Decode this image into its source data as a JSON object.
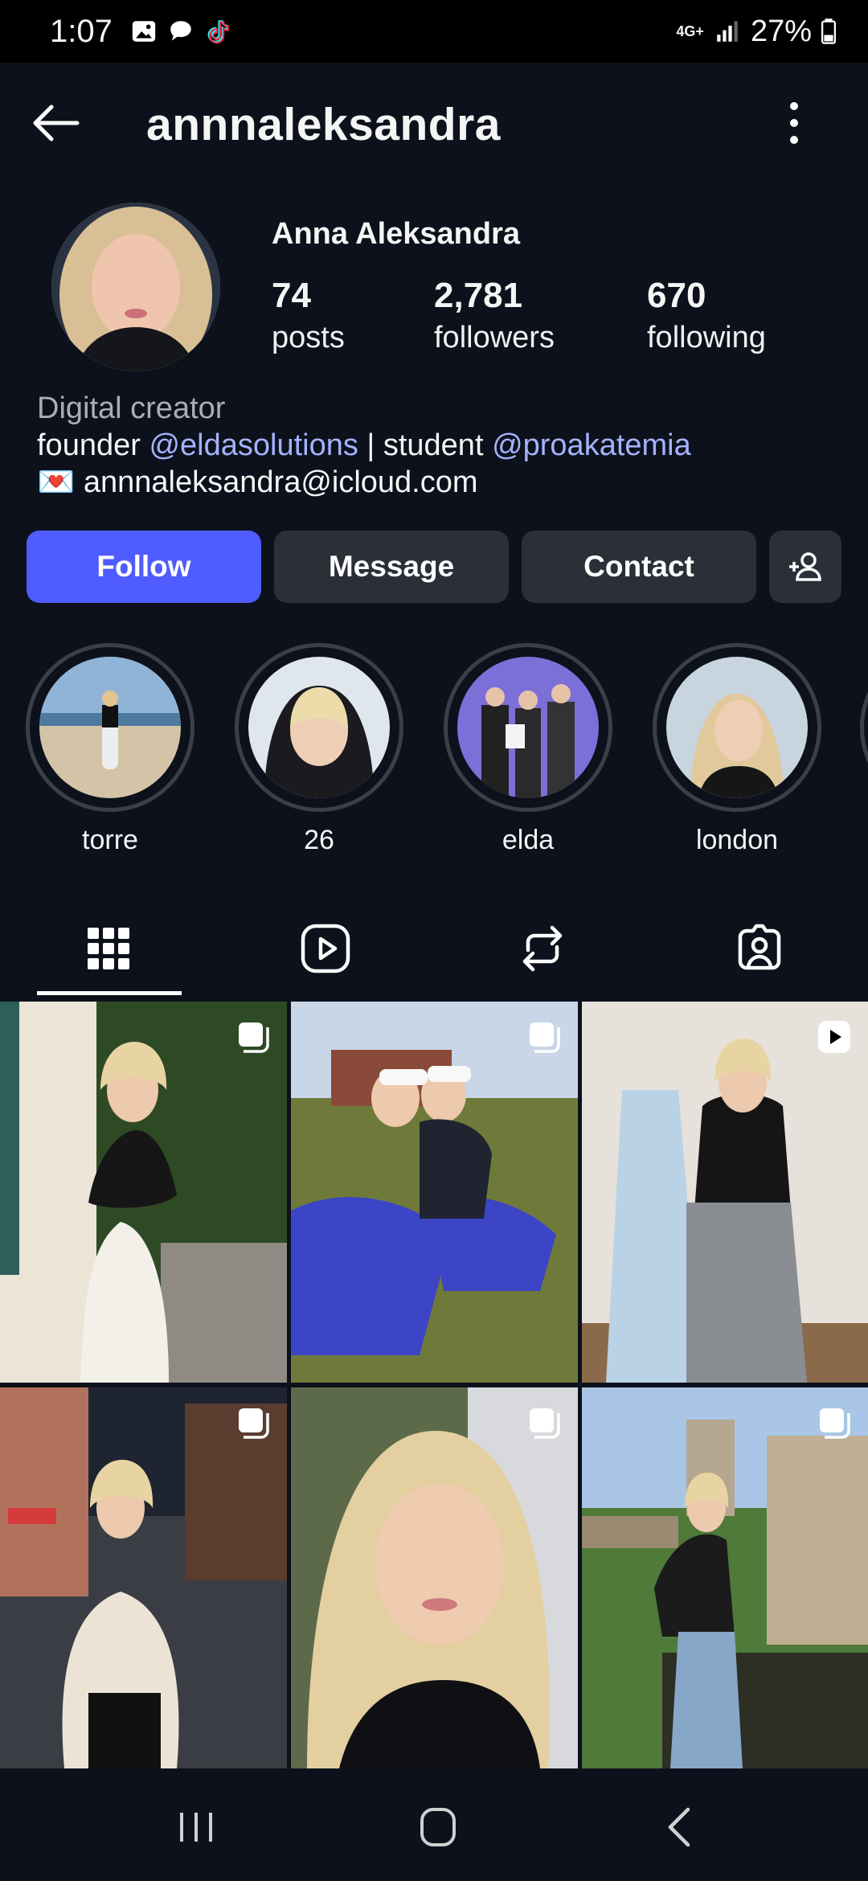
{
  "status_bar": {
    "time": "1:07",
    "network": "4G+",
    "battery": "27%"
  },
  "header": {
    "username": "annnaleksandra"
  },
  "profile": {
    "display_name": "Anna Aleksandra",
    "stats": [
      {
        "value": "74",
        "label": "posts"
      },
      {
        "value": "2,781",
        "label": "followers"
      },
      {
        "value": "670",
        "label": "following"
      }
    ],
    "bio": {
      "category": "Digital creator",
      "line1_prefix": "founder ",
      "mention1": "@eldasolutions",
      "line1_mid": " | student ",
      "mention2": "@proakatemia",
      "email_emoji": "💌",
      "email": "annnaleksandra@icloud.com"
    }
  },
  "actions": {
    "follow": "Follow",
    "message": "Message",
    "contact": "Contact"
  },
  "highlights": [
    {
      "label": "torre"
    },
    {
      "label": "26"
    },
    {
      "label": "elda"
    },
    {
      "label": "london"
    }
  ],
  "colors": {
    "background": "#0c111b",
    "accent": "#4f5cff",
    "mention": "#a4b2ff",
    "button_secondary": "#2a2f38"
  }
}
